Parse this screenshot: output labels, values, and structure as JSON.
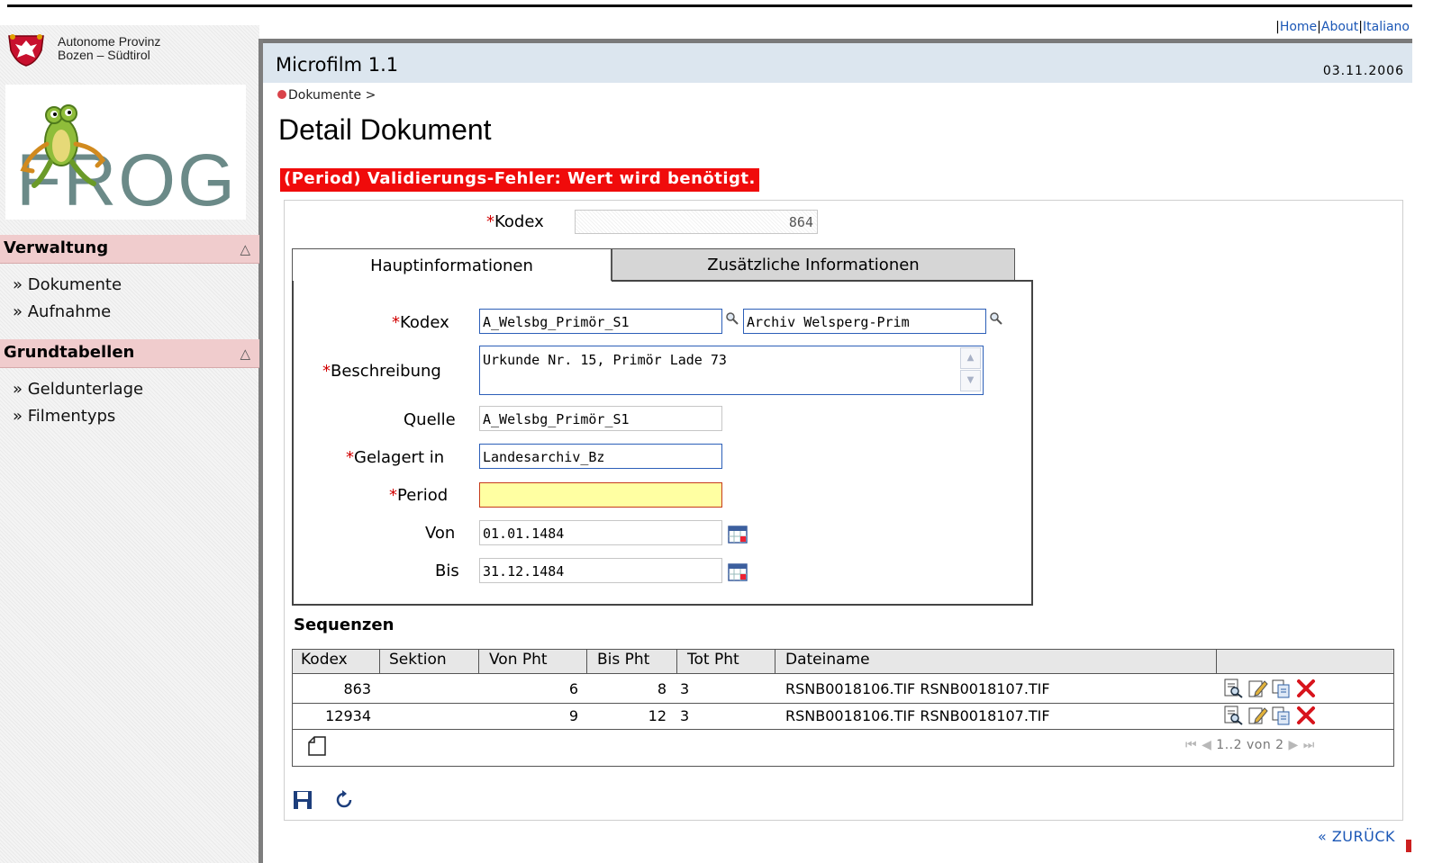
{
  "org": {
    "line1": "Autonome Provinz",
    "line2": "Bozen – Südtirol"
  },
  "logo": {
    "word": "FROG"
  },
  "sidebar": {
    "sections": [
      {
        "title": "Verwaltung",
        "items": [
          "» Dokumente",
          "» Aufnahme"
        ]
      },
      {
        "title": "Grundtabellen",
        "items": [
          "» Geldunterlage",
          "» Filmentyps"
        ]
      }
    ],
    "toggle_symbol": "△"
  },
  "toplinks": {
    "home": "Home",
    "about": "About",
    "lang": "Italiano"
  },
  "app": {
    "title": "Microfilm 1.1",
    "date": "03.11.2006"
  },
  "breadcrumb": "Dokumente >",
  "page_title": "Detail Dokument",
  "error_message": "(Period) Validierungs-Fehler: Wert wird benötigt.",
  "form": {
    "kodex_top": {
      "label": "Kodex",
      "value": "864"
    },
    "tabs": [
      "Hauptinformationen",
      "Zusätzliche Informationen"
    ],
    "fields": {
      "kodex": {
        "label": "Kodex",
        "value": "A_Welsbg_Primör_S1",
        "value2": "Archiv Welsperg-Prim"
      },
      "beschreibung": {
        "label": "Beschreibung",
        "value": "Urkunde Nr. 15, Primör Lade 73"
      },
      "quelle": {
        "label": "Quelle",
        "value": "A_Welsbg_Primör_S1"
      },
      "gelagert": {
        "label": "Gelagert in",
        "value": "Landesarchiv_Bz"
      },
      "period": {
        "label": "Period",
        "value": ""
      },
      "von": {
        "label": "Von",
        "value": "01.01.1484"
      },
      "bis": {
        "label": "Bis",
        "value": "31.12.1484"
      }
    },
    "required_mark": "*"
  },
  "sequences": {
    "title": "Sequenzen",
    "columns": [
      "Kodex",
      "Sektion",
      "Von Pht",
      "Bis Pht",
      "Tot Pht",
      "Dateiname"
    ],
    "rows": [
      {
        "kodex": "863",
        "sektion": "",
        "von": "6",
        "bis": "8",
        "tot": "3",
        "datei": "RSNB0018106.TIF RSNB0018107.TIF"
      },
      {
        "kodex": "12934",
        "sektion": "",
        "von": "9",
        "bis": "12",
        "tot": "3",
        "datei": "RSNB0018106.TIF RSNB0018107.TIF"
      }
    ],
    "pager": {
      "first": "⏮",
      "prev": "◀",
      "text": "1..2 von 2",
      "next": "▶",
      "last": "⏭"
    }
  },
  "footer": {
    "back": "« ZURÜCK"
  },
  "colors": {
    "error_bg": "#f00b0b",
    "section_bg": "#f0cccd",
    "appbar_bg": "#dce6ef",
    "link": "#1b57b6",
    "period_bg": "#ffffa2"
  }
}
